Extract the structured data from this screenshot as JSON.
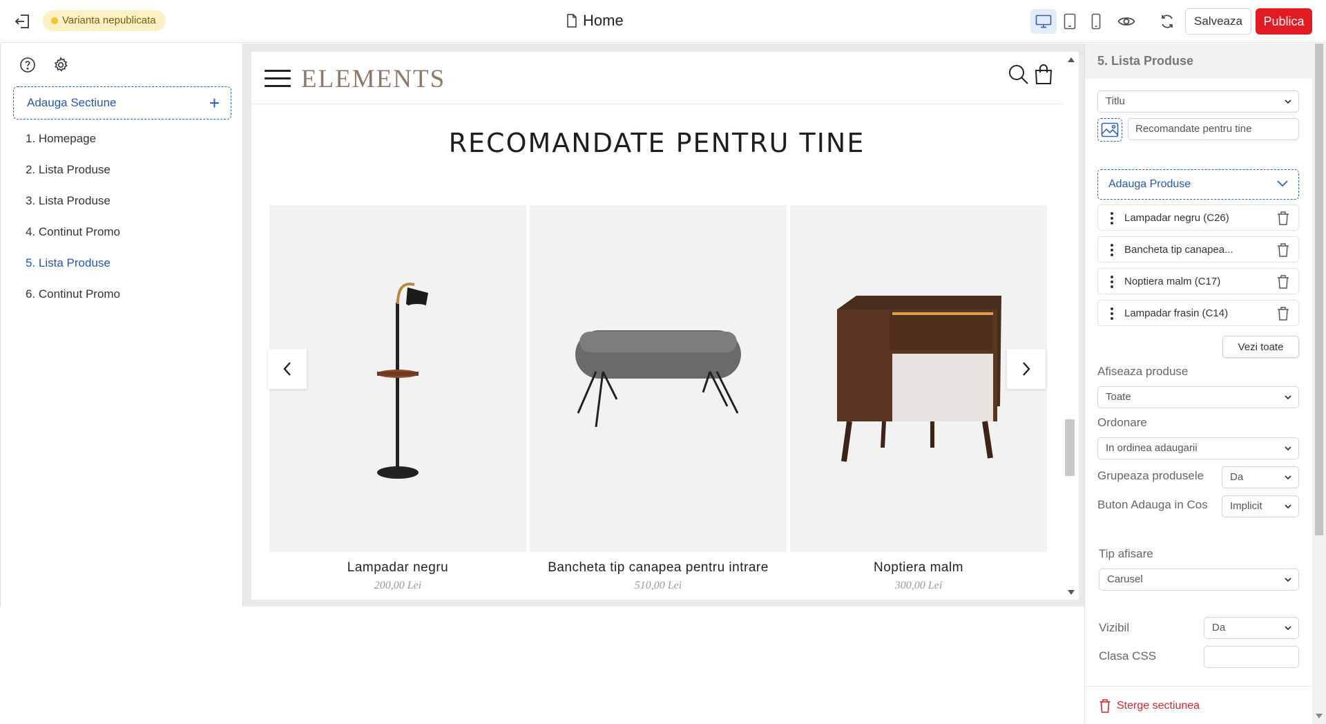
{
  "topbar": {
    "status_badge": "Varianta nepublicata",
    "page_title": "Home",
    "save_label": "Salveaza",
    "publish_label": "Publica",
    "active_device": "desktop",
    "colors": {
      "publish": "#e21b22",
      "badge_bg": "#fdf0c4",
      "accent": "#2458b0"
    }
  },
  "sidebar": {
    "add_section_label": "Adauga Sectiune",
    "sections": [
      {
        "label": "1. Homepage"
      },
      {
        "label": "2. Lista Produse"
      },
      {
        "label": "3. Lista Produse"
      },
      {
        "label": "4. Continut Promo"
      },
      {
        "label": "5. Lista Produse"
      },
      {
        "label": "6. Continut Promo"
      }
    ],
    "active_index": 4
  },
  "preview": {
    "logo": "ELEMENTS",
    "section_title": "RECOMANDATE PENTRU TINE",
    "products": [
      {
        "name": "Lampadar negru",
        "price": "200,00 Lei"
      },
      {
        "name": "Bancheta tip canapea pentru intrare",
        "price": "510,00 Lei"
      },
      {
        "name": "Noptiera malm",
        "price": "300,00 Lei"
      }
    ]
  },
  "panel": {
    "title": "5. Lista Produse",
    "title_type_select": "Titlu",
    "title_input": "Recomandate pentru tine",
    "add_products_label": "Adauga Produse",
    "product_items": [
      {
        "label": "Lampadar negru (C26)"
      },
      {
        "label": "Bancheta tip canapea..."
      },
      {
        "label": "Noptiera malm (C17)"
      },
      {
        "label": "Lampadar frasin (C14)"
      }
    ],
    "see_all_label": "Vezi toate",
    "show_products_label": "Afiseaza produse",
    "show_products_value": "Toate",
    "ordering_label": "Ordonare",
    "ordering_value": "In ordinea adaugarii",
    "group_label": "Grupeaza produsele",
    "group_value": "Da",
    "cart_button_label": "Buton Adauga in Cos",
    "cart_button_value": "Implicit",
    "display_type_label": "Tip afisare",
    "display_type_value": "Carusel",
    "visible_label": "Vizibil",
    "visible_value": "Da",
    "css_class_label": "Clasa CSS",
    "css_class_value": "",
    "delete_label": "Sterge sectiunea"
  }
}
